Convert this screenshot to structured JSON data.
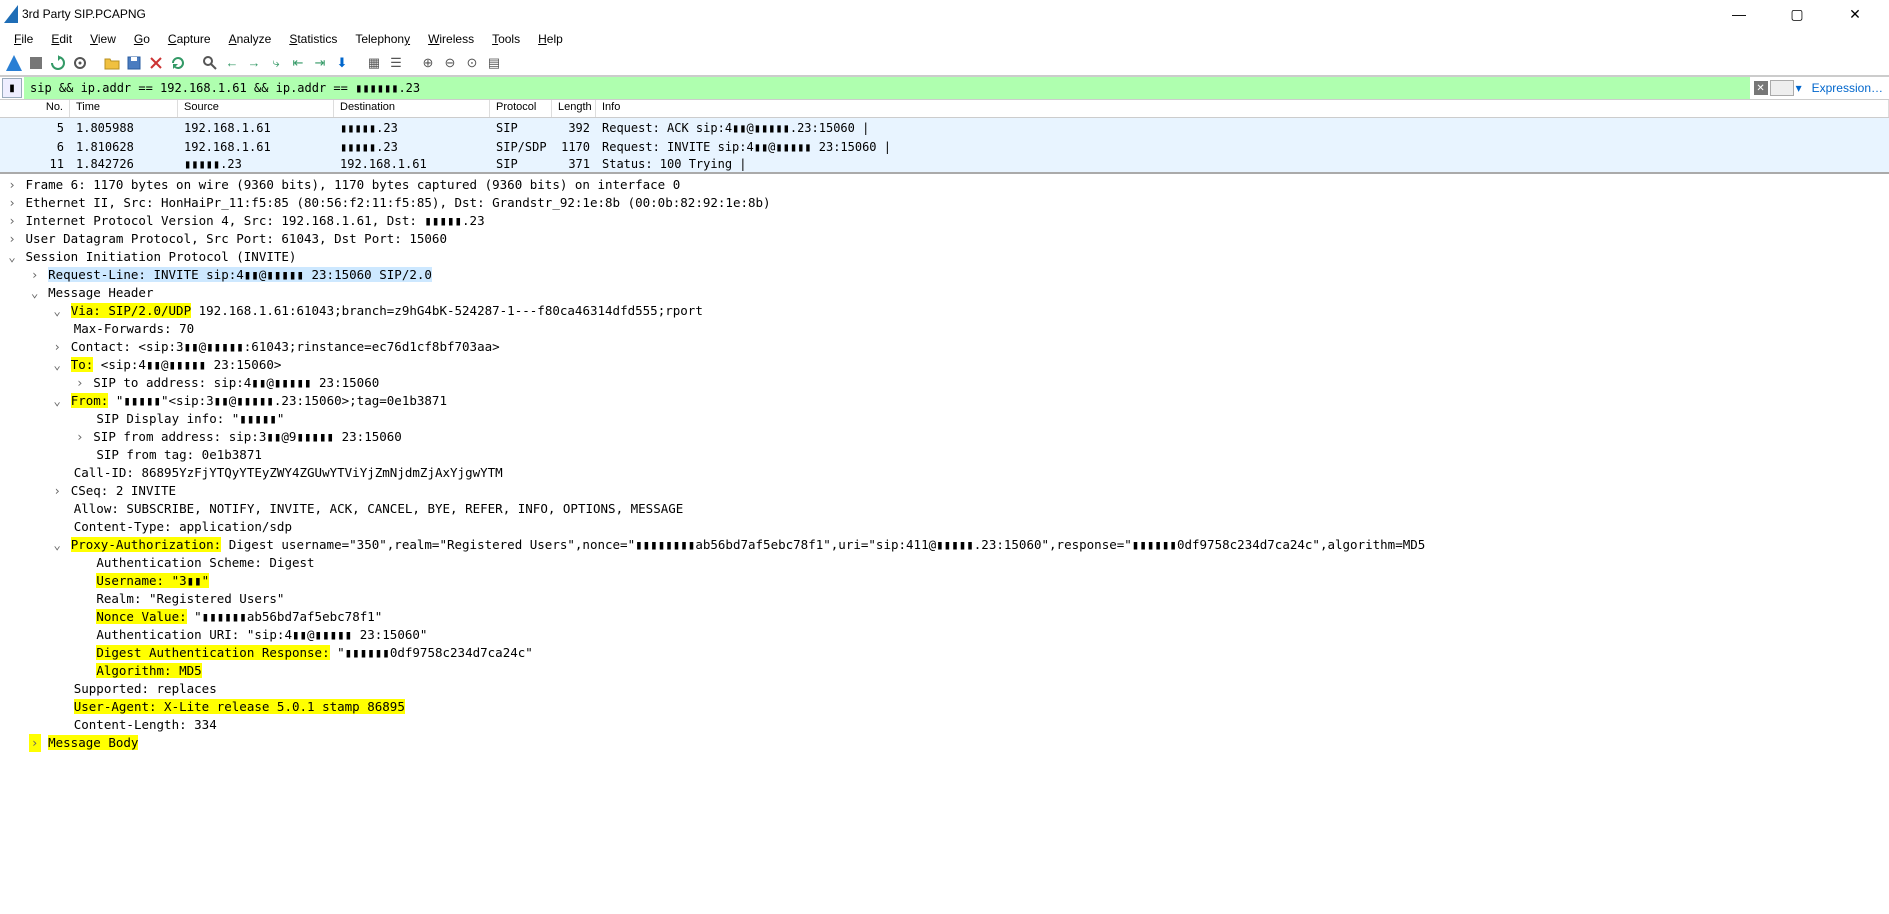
{
  "window": {
    "title": "3rd Party SIP.PCAPNG"
  },
  "menu": {
    "file": "File",
    "edit": "Edit",
    "view": "View",
    "go": "Go",
    "capture": "Capture",
    "analyze": "Analyze",
    "statistics": "Statistics",
    "telephony": "Telephony",
    "wireless": "Wireless",
    "tools": "Tools",
    "help": "Help"
  },
  "filter": {
    "value": "sip && ip.addr == 192.168.1.61 && ip.addr == ▮▮▮▮▮▮.23",
    "expression": "Expression…"
  },
  "columns": {
    "no": "No.",
    "time": "Time",
    "source": "Source",
    "destination": "Destination",
    "protocol": "Protocol",
    "length": "Length",
    "info": "Info"
  },
  "packets": [
    {
      "no": "5",
      "time": "1.805988",
      "src": "192.168.1.61",
      "dst": "▮▮▮▮▮.23",
      "proto": "SIP",
      "len": "392",
      "info": "Request: ACK sip:4▮▮@▮▮▮▮▮.23:15060 |"
    },
    {
      "no": "6",
      "time": "1.810628",
      "src": "192.168.1.61",
      "dst": "▮▮▮▮▮.23",
      "proto": "SIP/SDP",
      "len": "1170",
      "info": "Request: INVITE sip:4▮▮@▮▮▮▮▮ 23:15060 |"
    },
    {
      "no": "11",
      "time": "1.842726",
      "src": "▮▮▮▮▮.23",
      "dst": "192.168.1.61",
      "proto": "SIP",
      "len": "371",
      "info": "Status: 100 Trying |"
    }
  ],
  "details": {
    "frame": "Frame 6: 1170 bytes on wire (9360 bits), 1170 bytes captured (9360 bits) on interface 0",
    "eth": "Ethernet II, Src: HonHaiPr_11:f5:85 (80:56:f2:11:f5:85), Dst: Grandstr_92:1e:8b (00:0b:82:92:1e:8b)",
    "ip": "Internet Protocol Version 4, Src: 192.168.1.61, Dst: ▮▮▮▮▮.23",
    "udp": "User Datagram Protocol, Src Port: 61043, Dst Port: 15060",
    "sip": "Session Initiation Protocol (INVITE)",
    "reqline": "Request-Line: INVITE sip:4▮▮@▮▮▮▮▮ 23:15060 SIP/2.0",
    "msgheader": "Message Header",
    "via_hl": "Via: SIP/2.0/UDP",
    "via_rest": " 192.168.1.61:61043;branch=z9hG4bK-524287-1---f80ca46314dfd555;rport",
    "maxfwd": "Max-Forwards: 70",
    "contact": "Contact: <sip:3▮▮@▮▮▮▮▮:61043;rinstance=ec76d1cf8bf703aa>",
    "to_hl": "To:",
    "to_rest": " <sip:4▮▮@▮▮▮▮▮ 23:15060>",
    "siptoaddr": "SIP to address: sip:4▮▮@▮▮▮▮▮ 23:15060",
    "from_hl": "From:",
    "from_rest": " \"▮▮▮▮▮\"<sip:3▮▮@▮▮▮▮▮.23:15060>;tag=0e1b3871",
    "sipdisp": "SIP Display info: \"▮▮▮▮▮\"",
    "sipfromaddr": "SIP from address: sip:3▮▮@9▮▮▮▮▮ 23:15060",
    "sipfromtag": "SIP from tag: 0e1b3871",
    "callid": "Call-ID: 86895YzFjYTQyYTEyZWY4ZGUwYTViYjZmNjdmZjAxYjgwYTM",
    "cseq": "CSeq: 2 INVITE",
    "allow": "Allow: SUBSCRIBE, NOTIFY, INVITE, ACK, CANCEL, BYE, REFER, INFO, OPTIONS, MESSAGE",
    "ctype": "Content-Type: application/sdp",
    "proxy_hl": "Proxy-Authorization:",
    "proxy_rest": " Digest username=\"350\",realm=\"Registered Users\",nonce=\"▮▮▮▮▮▮▮▮ab56bd7af5ebc78f1\",uri=\"sip:411@▮▮▮▮▮.23:15060\",response=\"▮▮▮▮▮▮0df9758c234d7ca24c\",algorithm=MD5",
    "authscheme": "Authentication Scheme: Digest",
    "username_hl": "Username: \"3▮▮\"",
    "realm": "Realm: \"Registered Users\"",
    "nonce_hl": "Nonce Value:",
    "nonce_rest": " \"▮▮▮▮▮▮ab56bd7af5ebc78f1\"",
    "authuri": "Authentication URI: \"sip:4▮▮@▮▮▮▮▮ 23:15060\"",
    "digresp_hl": "Digest Authentication Response:",
    "digresp_rest": " \"▮▮▮▮▮▮0df9758c234d7ca24c\"",
    "algo_hl": "Algorithm: MD5",
    "supported": "Supported: replaces",
    "ua_hl": "User-Agent: X-Lite release 5.0.1 stamp 86895",
    "clen": "Content-Length: 334",
    "msgbody": "Message Body"
  }
}
